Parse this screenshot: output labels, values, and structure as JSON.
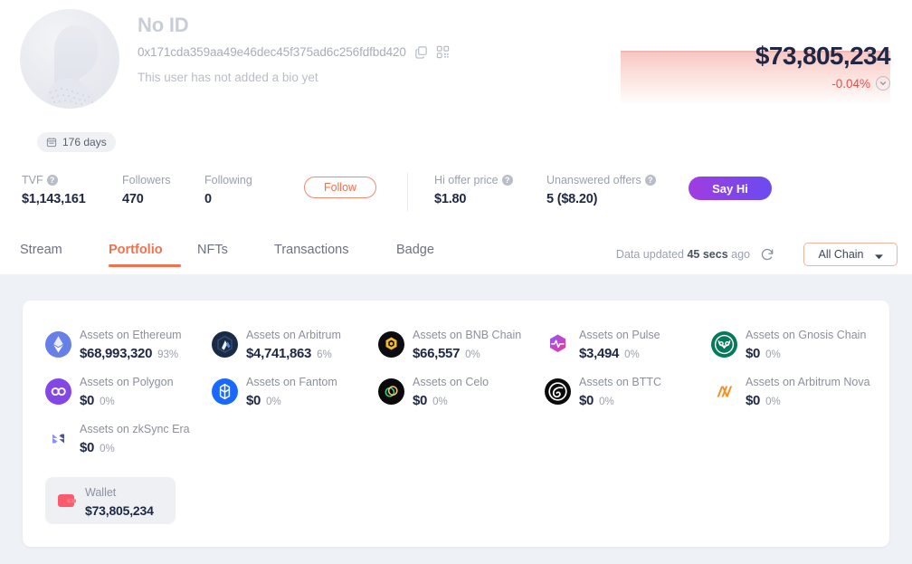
{
  "profile": {
    "display_name": "No ID",
    "address": "0x171cda359aa49e46dec45f375ad6c256fdfbd420",
    "bio": "This user has not added a bio yet",
    "age_badge": "176 days"
  },
  "portfolio_value": {
    "total": "$73,805,234",
    "change": "-0.04%",
    "change_color": "#ed4b48"
  },
  "stats": {
    "tvf_label": "TVF",
    "tvf_value": "$1,143,161",
    "followers_label": "Followers",
    "followers_value": "470",
    "following_label": "Following",
    "following_value": "0",
    "follow_button": "Follow",
    "hi_offer_label": "Hi offer price",
    "hi_offer_value": "$1.80",
    "unanswered_label": "Unanswered offers",
    "unanswered_value": "5 ($8.20)",
    "say_hi_button": "Say Hi"
  },
  "tabs": [
    {
      "label": "Stream",
      "active": false
    },
    {
      "label": "Portfolio",
      "active": true
    },
    {
      "label": "NFTs",
      "active": false
    },
    {
      "label": "Transactions",
      "active": false
    },
    {
      "label": "Badge",
      "active": false
    }
  ],
  "toolbar": {
    "updated_prefix": "Data updated",
    "updated_time": "45 secs",
    "updated_suffix": "ago",
    "chain_filter": "All Chain"
  },
  "assets": [
    {
      "name": "Assets on Ethereum",
      "value": "$68,993,320",
      "pct": "93%"
    },
    {
      "name": "Assets on Arbitrum",
      "value": "$4,741,863",
      "pct": "6%"
    },
    {
      "name": "Assets on BNB Chain",
      "value": "$66,557",
      "pct": "0%"
    },
    {
      "name": "Assets on Pulse",
      "value": "$3,494",
      "pct": "0%"
    },
    {
      "name": "Assets on Gnosis Chain",
      "value": "$0",
      "pct": "0%"
    },
    {
      "name": "Assets on Polygon",
      "value": "$0",
      "pct": "0%"
    },
    {
      "name": "Assets on Fantom",
      "value": "$0",
      "pct": "0%"
    },
    {
      "name": "Assets on Celo",
      "value": "$0",
      "pct": "0%"
    },
    {
      "name": "Assets on BTTC",
      "value": "$0",
      "pct": "0%"
    },
    {
      "name": "Assets on Arbitrum Nova",
      "value": "$0",
      "pct": "0%"
    },
    {
      "name": "Assets on zkSync Era",
      "value": "$0",
      "pct": "0%"
    }
  ],
  "wallet": {
    "label": "Wallet",
    "value": "$73,805,234"
  },
  "icons": {
    "copy": "copy-icon",
    "qr": "qr-code-icon",
    "calendar": "calendar-icon",
    "refresh": "refresh-icon",
    "chevron_down": "chevron-down-icon",
    "wallet": "wallet-icon"
  },
  "colors": {
    "accent": "#f0714f",
    "negative": "#ed4b48",
    "page_bg": "#eef1f6"
  }
}
